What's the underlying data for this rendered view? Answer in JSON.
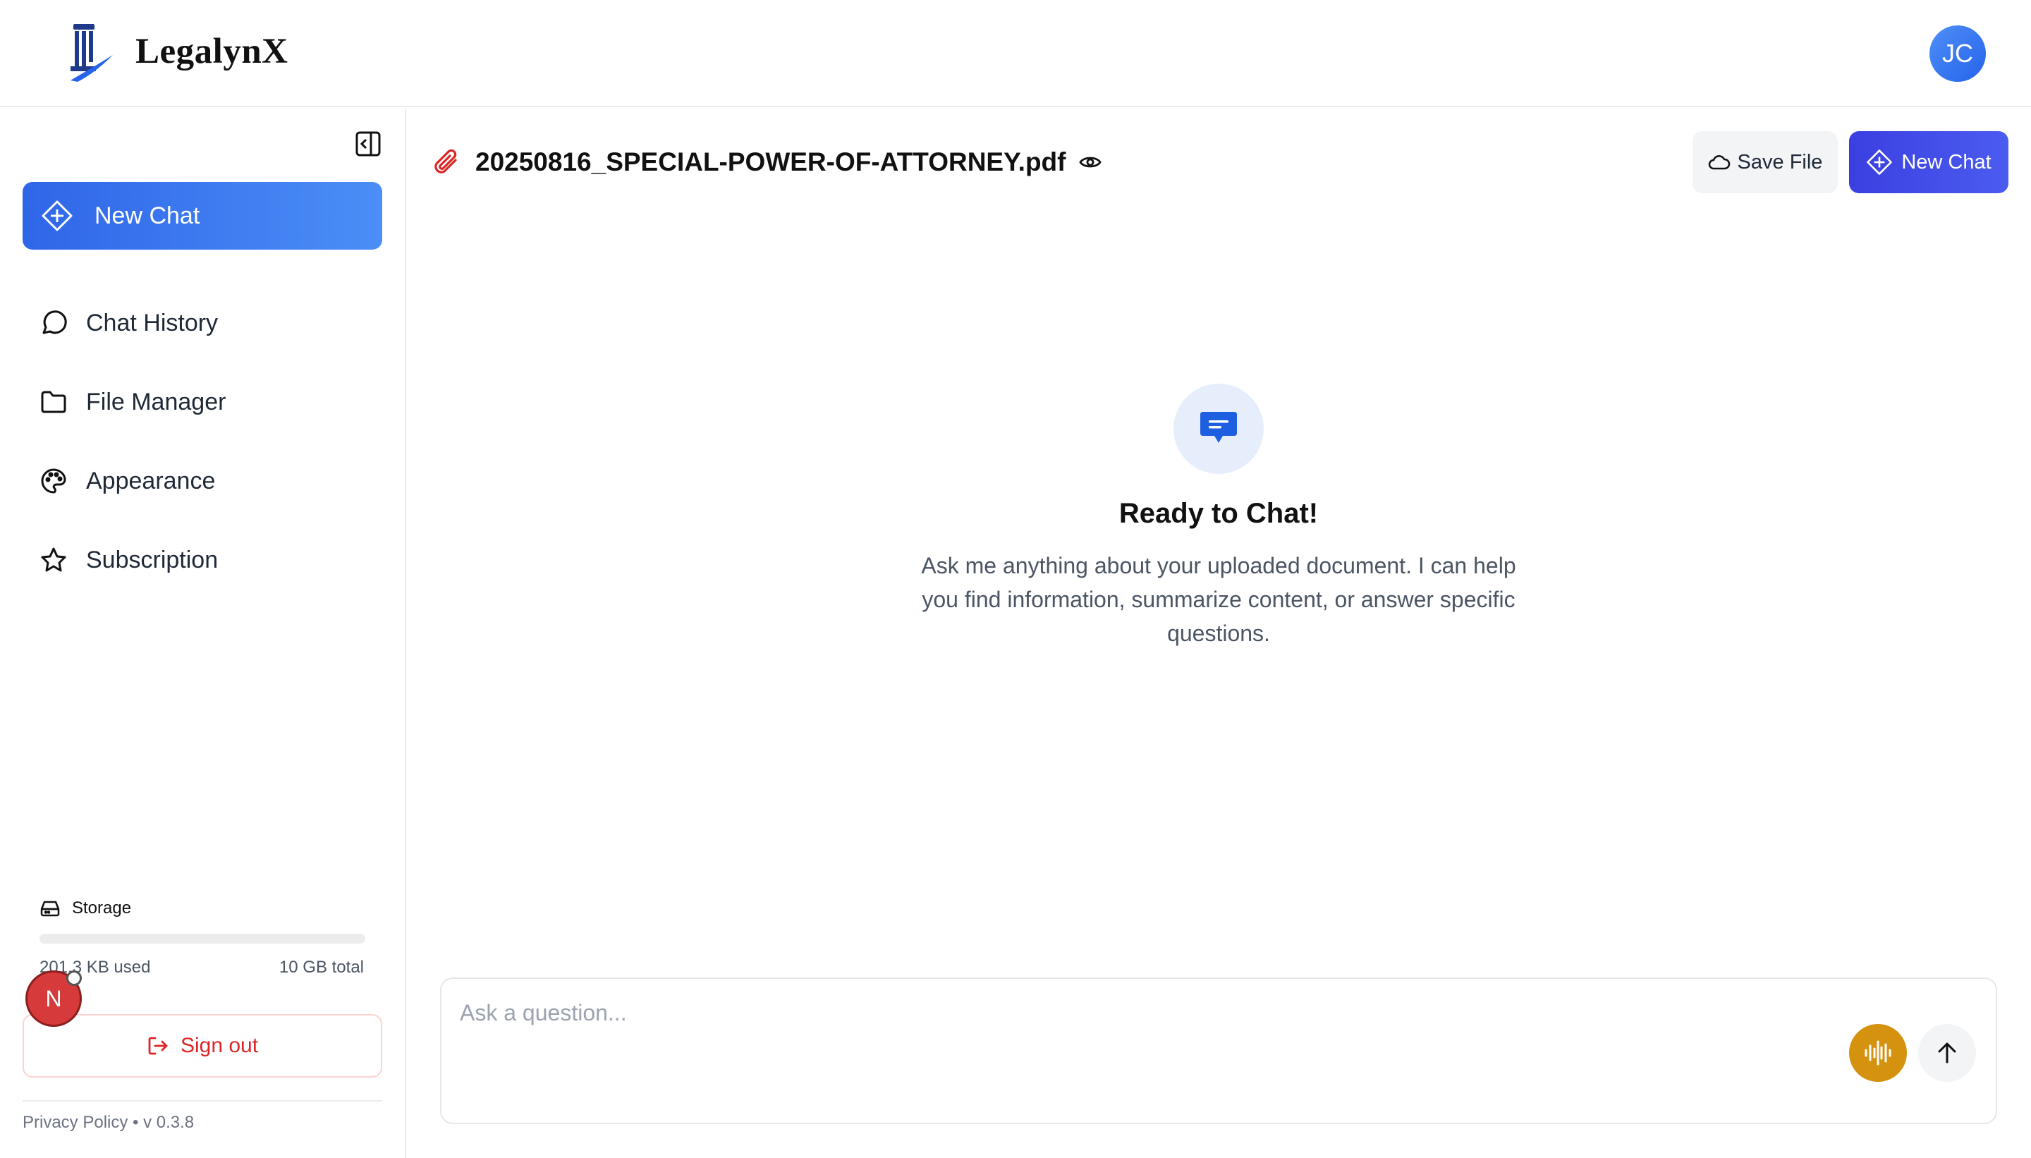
{
  "header": {
    "brand": "LegalynX",
    "avatar_initials": "JC"
  },
  "sidebar": {
    "items": [
      {
        "label": "New Chat",
        "icon": "plus-circle-icon"
      },
      {
        "label": "Chat History",
        "icon": "message-circle-icon"
      },
      {
        "label": "File Manager",
        "icon": "folder-icon"
      },
      {
        "label": "Appearance",
        "icon": "palette-icon"
      },
      {
        "label": "Subscription",
        "icon": "star-icon"
      }
    ],
    "storage": {
      "label": "Storage",
      "used": "201.3 KB used",
      "total": "10 GB total",
      "used_fraction": 2e-05
    },
    "sign_out": "Sign out",
    "footer": "Privacy Policy • v 0.3.8",
    "badge": "N"
  },
  "main": {
    "file_name": "20250816_SPECIAL-POWER-OF-ATTORNEY.pdf",
    "save_file": "Save File",
    "new_chat": "New Chat",
    "empty_state": {
      "title": "Ready to Chat!",
      "description": "Ask me anything about your uploaded document. I can help you find information, summarize content, or answer specific questions."
    },
    "input": {
      "placeholder": "Ask a question...",
      "value": ""
    }
  },
  "colors": {
    "accent": "#2f66e8",
    "new_chat_button": "#3b3fe0",
    "sign_out": "#dc2626",
    "voice_button": "#d4920f"
  }
}
